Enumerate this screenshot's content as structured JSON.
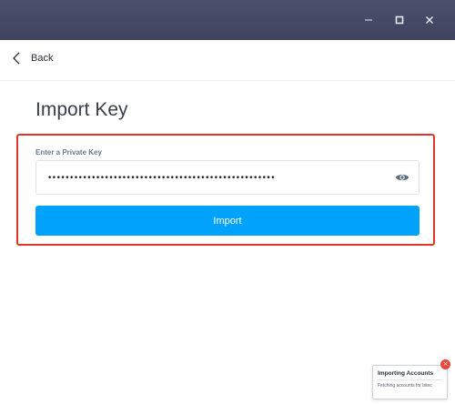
{
  "window": {
    "controls": [
      "minimize",
      "maximize",
      "close"
    ]
  },
  "nav": {
    "back_label": "Back"
  },
  "page": {
    "title": "Import Key"
  },
  "form": {
    "field_label": "Enter a Private Key",
    "private_key_masked": "••••••••••••••••••••••••••••••••••••••••••••••••••••",
    "submit_label": "Import"
  },
  "toast": {
    "title": "Importing Accounts",
    "message": "Fetching accounts for bitec",
    "close_symbol": "×"
  },
  "colors": {
    "titlebar": "#474c68",
    "accent": "#00a2fb",
    "highlight": "#e0352c",
    "toast_close": "#e8473c"
  }
}
